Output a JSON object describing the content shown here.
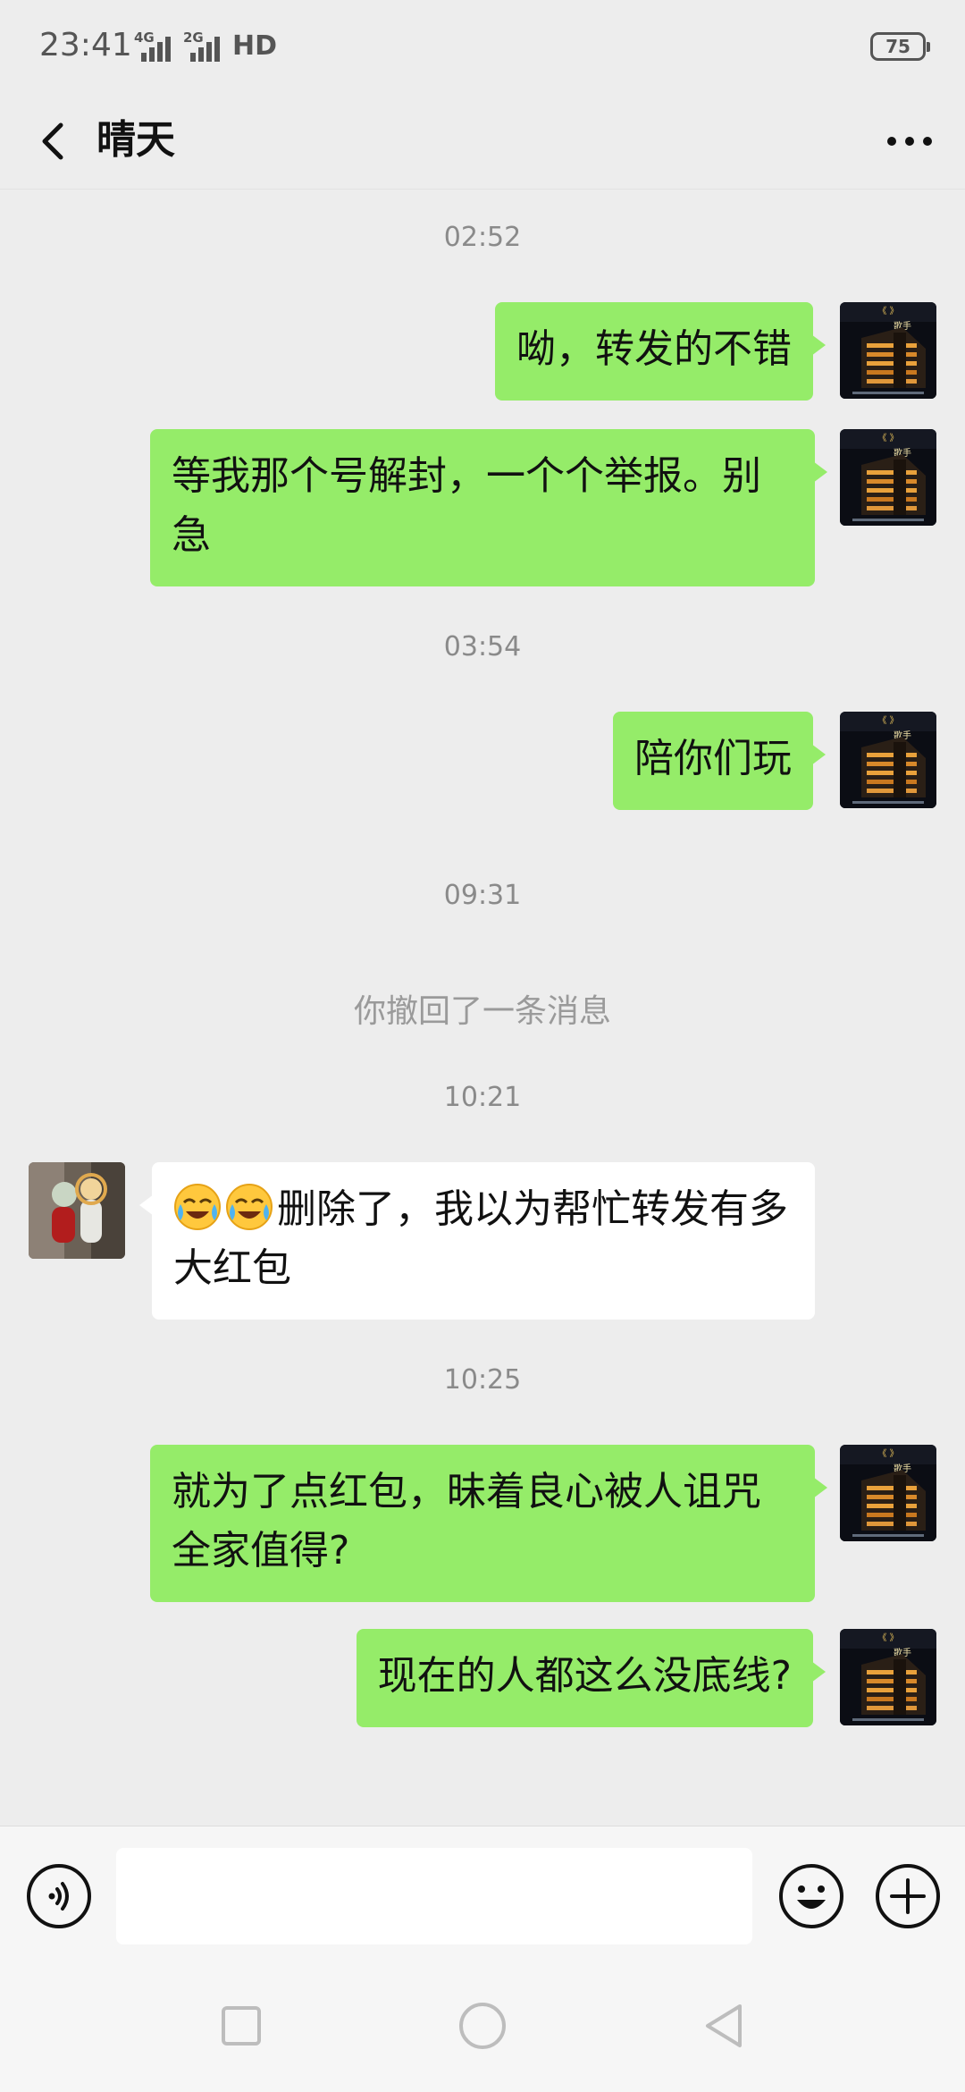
{
  "status_bar": {
    "time": "23:41",
    "network_1": "4G",
    "network_2": "2G",
    "hd_label": "HD",
    "battery": "75"
  },
  "header": {
    "title": "晴天",
    "back_icon": "chevron-left-icon",
    "more_icon": "more-dots-icon"
  },
  "messages": {
    "ts1": "02:52",
    "m1": "呦，转发的不错",
    "m2": "等我那个号解封，一个个举报。别急",
    "ts2": "03:54",
    "m3": "陪你们玩",
    "ts3": "09:31",
    "recall": "你撤回了一条消息",
    "ts4": "10:21",
    "m4_emojis": [
      "crying-laughing-emoji",
      "crying-laughing-emoji"
    ],
    "m4": "删除了，我以为帮忙转发有多大红包",
    "ts5": "10:25",
    "m5": "就为了点红包，昧着良心被人诅咒全家值得?",
    "m6": "现在的人都这么没底线?"
  },
  "input_bar": {
    "voice_icon": "voice-icon",
    "emoji_icon": "smiley-icon",
    "plus_icon": "plus-icon",
    "text": ""
  },
  "nav_bar": {
    "recent_icon": "square-icon",
    "home_icon": "circle-icon",
    "back_icon": "triangle-back-icon"
  },
  "colors": {
    "background": "#ededed",
    "my_bubble": "#95ec69",
    "other_bubble": "#ffffff",
    "timestamp_text": "#8a8a8a"
  }
}
